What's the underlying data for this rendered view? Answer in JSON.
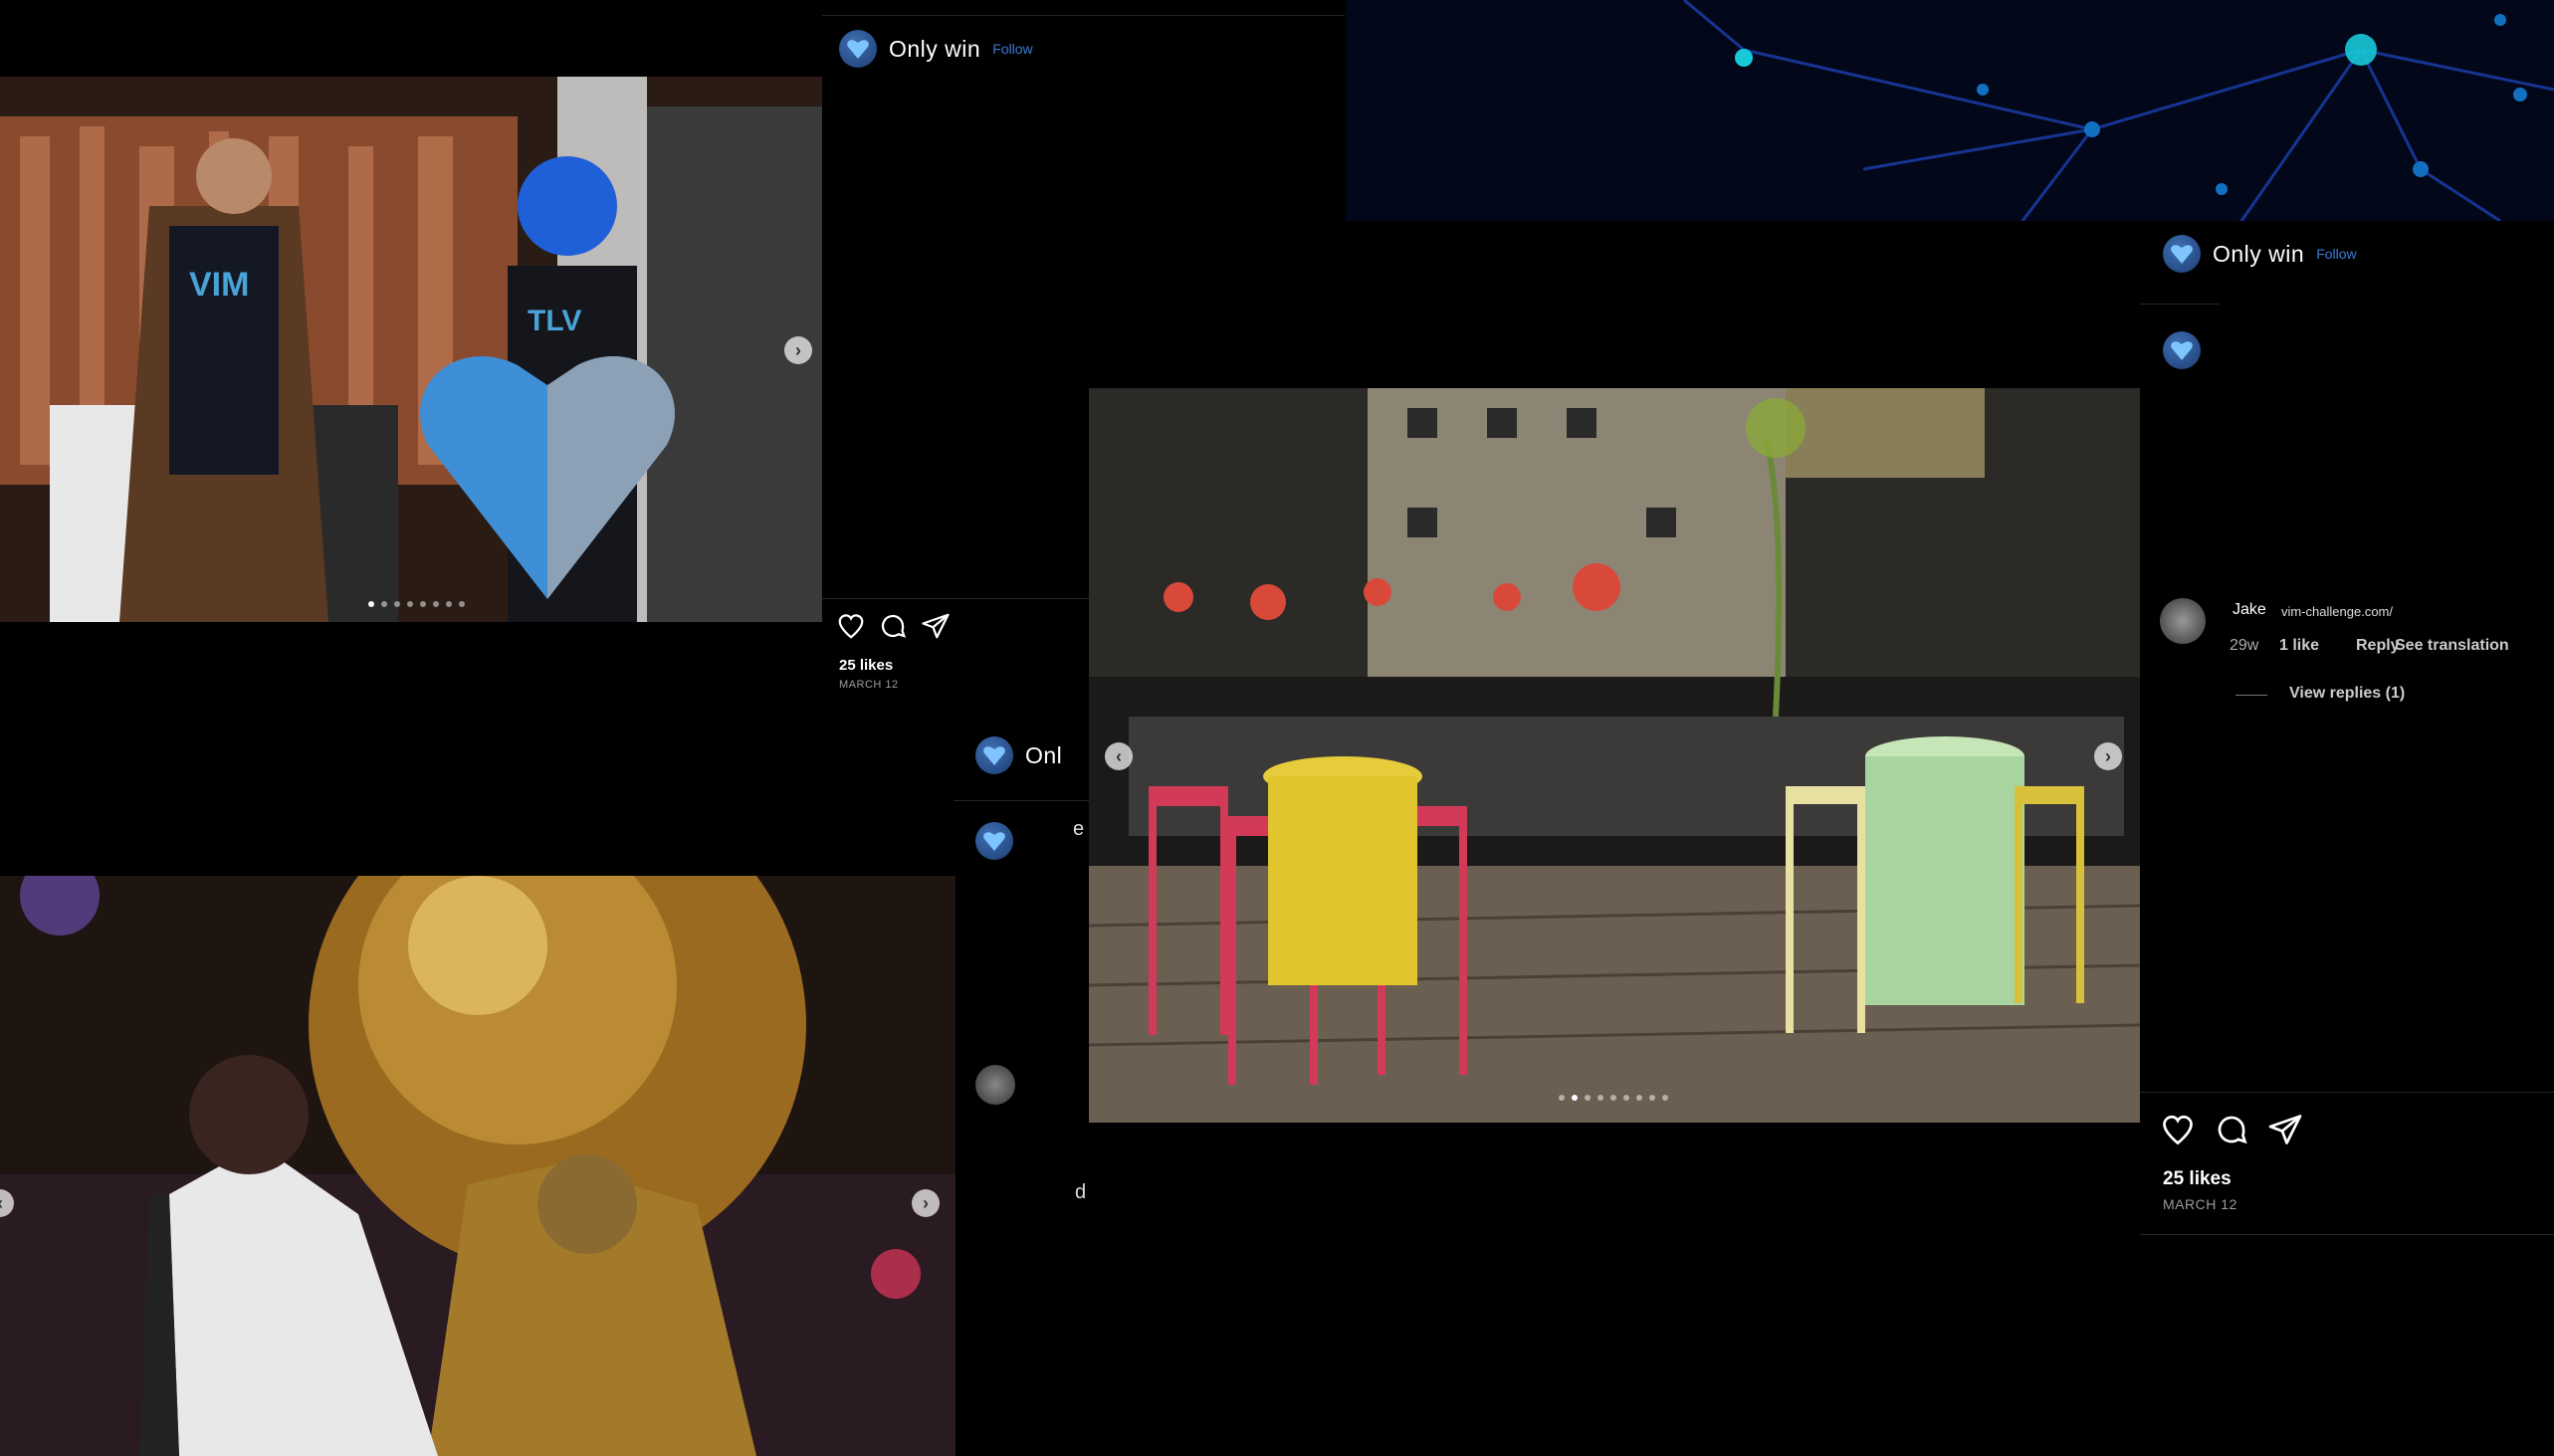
{
  "post_top": {
    "username": "Only win",
    "follow_label": "Follow",
    "likes": "25 likes",
    "date": "MARCH 12"
  },
  "post_middle": {
    "username_partial": "Onl",
    "partial_char_1": "e",
    "partial_char_2": "d"
  },
  "post_right": {
    "username": "Only win",
    "follow_label": "Follow",
    "comment": {
      "author": "Jake",
      "text": "vim-challenge.com/",
      "age": "29w",
      "likes": "1 like",
      "reply_label": "Reply",
      "translate_label": "See translation",
      "view_replies": "View replies (1)"
    },
    "likes": "25 likes",
    "date": "MARCH 12"
  },
  "photos": {
    "stage": {
      "shirt_text_1": "VIM",
      "shirt_text_2": "TLV"
    }
  },
  "carousel": {
    "stage_dots_total": 8,
    "stage_dots_active": 0,
    "terrace_dots_total": 9,
    "terrace_dots_active": 1
  },
  "colors": {
    "background": "#000000",
    "accent_blue": "#3a7bd5",
    "logo_blue": "#2c5aa0",
    "network_cyan": "#18c9d8"
  },
  "icons": [
    "heart-icon",
    "comment-icon",
    "share-icon",
    "bookmark-icon",
    "chevron-right-icon",
    "chevron-left-icon"
  ]
}
